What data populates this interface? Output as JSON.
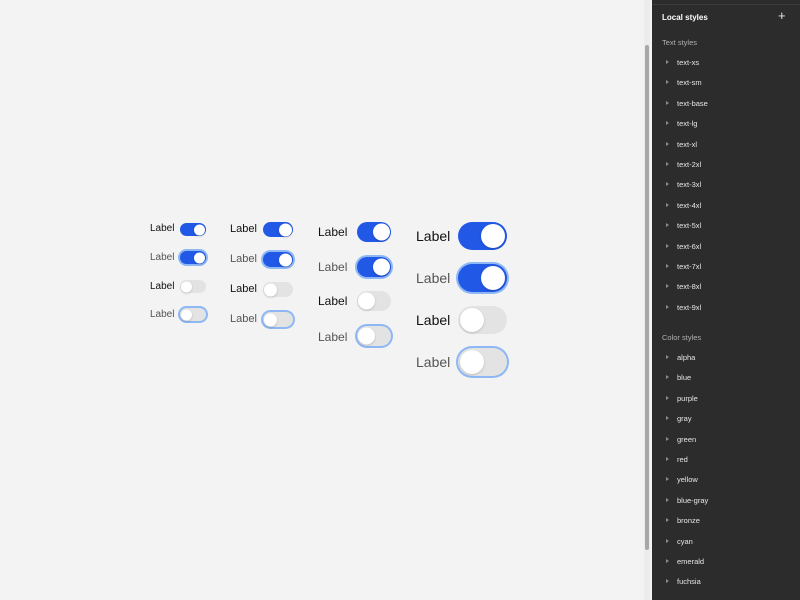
{
  "canvas": {
    "label": "Label"
  },
  "panel": {
    "title": "Local styles",
    "add_icon": "+",
    "text_styles_heading": "Text styles",
    "text_styles": [
      "text-xs",
      "text-sm",
      "text-base",
      "text-lg",
      "text-xl",
      "text-2xl",
      "text-3xl",
      "text-4xl",
      "text-5xl",
      "text-6xl",
      "text-7xl",
      "text-8xl",
      "text-9xl"
    ],
    "color_styles_heading": "Color styles",
    "color_styles": [
      "alpha",
      "blue",
      "purple",
      "gray",
      "green",
      "red",
      "yellow",
      "blue-gray",
      "bronze",
      "cyan",
      "emerald",
      "fuchsia"
    ]
  },
  "colors": {
    "accent": "#2158e6",
    "focus_ring": "#8db8f5",
    "off_track": "#e3e3e3",
    "panel_bg": "#2c2c2c"
  }
}
